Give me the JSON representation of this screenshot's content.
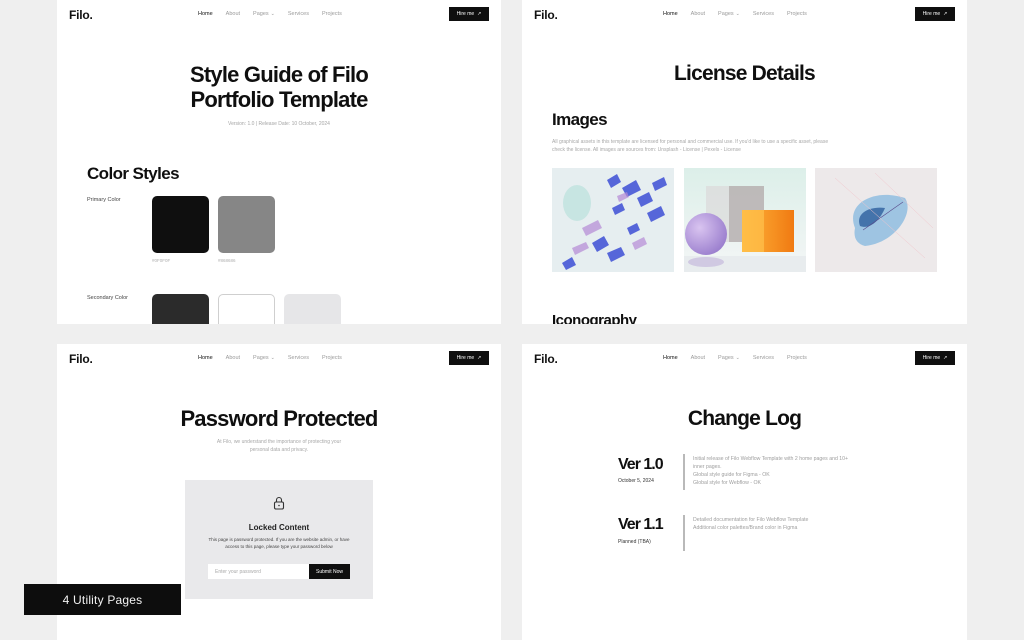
{
  "nav": {
    "logo": "Filo.",
    "items": [
      "Home",
      "About",
      "Pages",
      "Services",
      "Projects"
    ],
    "active": "Home",
    "pages_chevron": "⌄",
    "hire_label": "Hire me",
    "hire_icon": "↗"
  },
  "style_guide": {
    "title_line1": "Style Guide of Filo",
    "title_line2": "Portfolio Template",
    "version": "Version: 1.0 | Release Date: 10 October, 2024",
    "section": "Color Styles",
    "primary_label": "Primary Color",
    "primary_colors": [
      {
        "hex": "#0F0F0F",
        "color": "#0f0f0f"
      },
      {
        "hex": "#868686",
        "color": "#868686"
      }
    ],
    "secondary_label": "Secondary Color",
    "secondary_colors": [
      {
        "color": "#2b2b2b"
      },
      {
        "color": "#ffffff"
      },
      {
        "color": "#e6e6e8"
      }
    ]
  },
  "license": {
    "title": "License Details",
    "images_heading": "Images",
    "images_desc": "All graphical assets in this template are licensed for personal and commercial use. If you'd like to use a specific asset, please check the license. All images are sources from: Unsplash - License | Pexels - License",
    "images": [
      "abstract-blue-purple-image",
      "sphere-and-blocks-image",
      "blue-leaf-image"
    ],
    "iconography_heading": "Iconography"
  },
  "password": {
    "title": "Password Protected",
    "subtitle_line1": "At Filo, we understand the importance of protecting your",
    "subtitle_line2": "personal data and privacy.",
    "card_title": "Locked Content",
    "card_text": "This page is password protected. If you are the website admin, or have access to this page, please type your password below",
    "input_placeholder": "Enter your password",
    "submit_label": "Submit Now"
  },
  "changelog": {
    "title": "Change Log",
    "versions": [
      {
        "version": "Ver 1.0",
        "date": "October 5, 2024",
        "notes": [
          "Initial release of Filo Webflow Template with 2 home pages and 10+",
          "inner pages.",
          "Global style guide for Figma - OK",
          "Global style for Webflow - OK"
        ]
      },
      {
        "version": "Ver 1.1",
        "date": "Planned (TBA)",
        "notes": [
          "Detailed documentation for Filo Webflow Template",
          "Additional color palettes/Brand color in Figma"
        ]
      }
    ]
  },
  "badge": "4 Utility Pages"
}
